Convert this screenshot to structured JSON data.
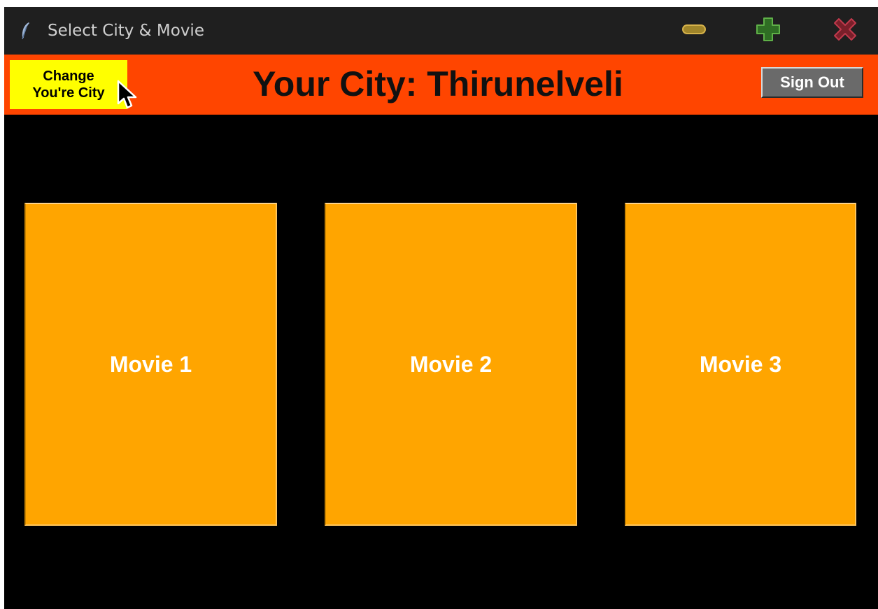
{
  "window": {
    "title": "Select City & Movie",
    "icons": {
      "app": "feather-icon",
      "minimize": "minimize-icon",
      "maximize": "maximize-plus-icon",
      "close": "close-x-icon"
    }
  },
  "header": {
    "change_city_line1": "Change",
    "change_city_line2": "You're City",
    "city_title": "Your City: Thirunelveli",
    "sign_out_label": "Sign Out"
  },
  "movies": [
    {
      "label": "Movie 1"
    },
    {
      "label": "Movie 2"
    },
    {
      "label": "Movie 3"
    }
  ],
  "colors": {
    "header_bg": "#ff4500",
    "change_city_bg": "#ffff00",
    "movie_card_bg": "#ffa500",
    "sign_out_bg": "#6a6a6a",
    "content_bg": "#000000"
  }
}
